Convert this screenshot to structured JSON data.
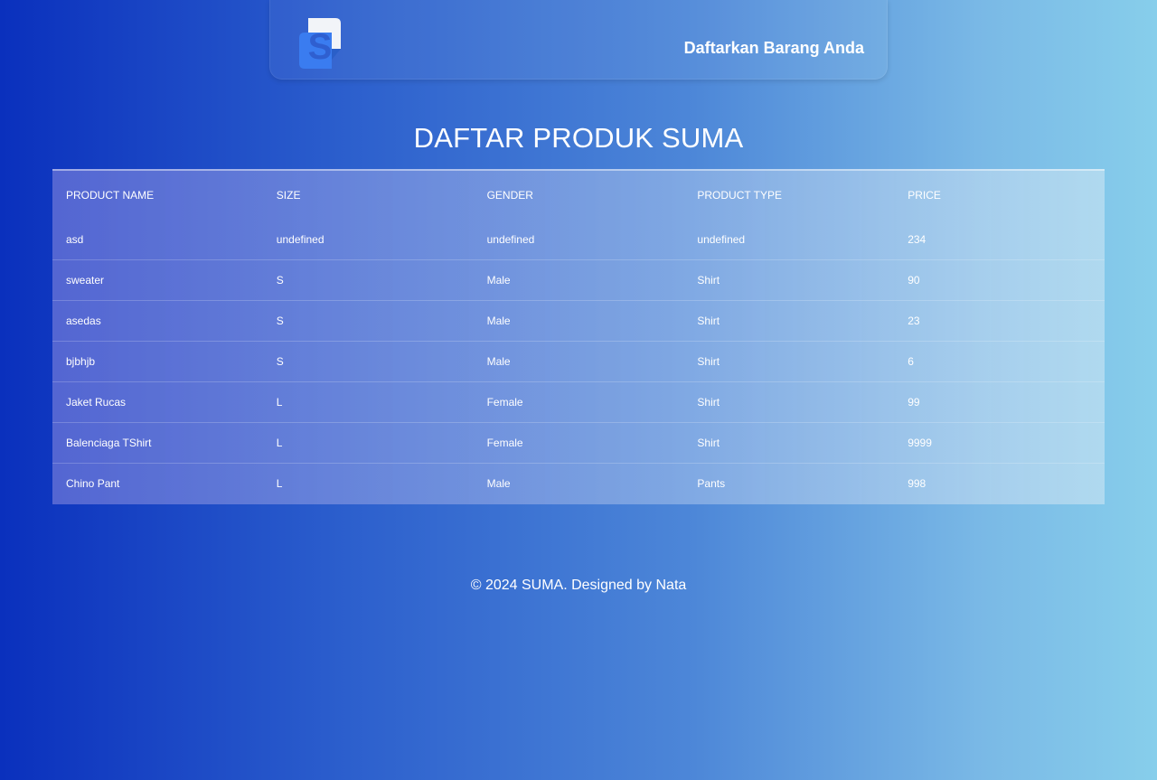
{
  "navbar": {
    "logo_letter": "S",
    "link_label": "Daftarkan Barang Anda"
  },
  "page": {
    "title": "DAFTAR PRODUK SUMA"
  },
  "table": {
    "headers": [
      "PRODUCT NAME",
      "SIZE",
      "GENDER",
      "PRODUCT TYPE",
      "PRICE"
    ],
    "rows": [
      [
        "asd",
        "undefined",
        "undefined",
        "undefined",
        "234"
      ],
      [
        "sweater",
        "S",
        "Male",
        "Shirt",
        "90"
      ],
      [
        "asedas",
        "S",
        "Male",
        "Shirt",
        "23"
      ],
      [
        "bjbhjb",
        "S",
        "Male",
        "Shirt",
        "6"
      ],
      [
        "Jaket Rucas",
        "L",
        "Female",
        "Shirt",
        "99"
      ],
      [
        "Balenciaga TShirt",
        "L",
        "Female",
        "Shirt",
        "9999"
      ],
      [
        "Chino Pant",
        "L",
        "Male",
        "Pants",
        "998"
      ]
    ]
  },
  "footer": {
    "text": "© 2024 SUMA. Designed by Nata"
  },
  "colors": {
    "gradient_start": "#0a30bd",
    "gradient_end": "#87ceeb",
    "logo_blue": "#3a7cf0",
    "logo_white": "#f2f4f8"
  }
}
